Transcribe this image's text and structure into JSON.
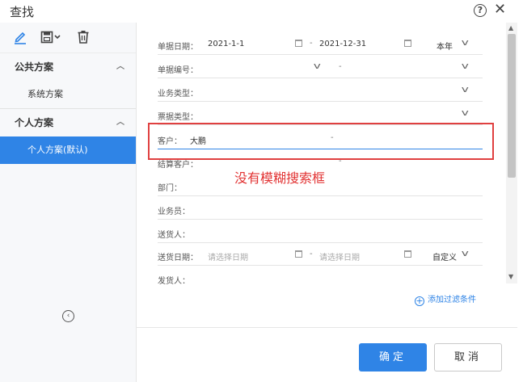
{
  "window": {
    "title": "查找",
    "help_glyph": "?",
    "close_glyph": "✕"
  },
  "sidebar": {
    "public_group": "公共方案",
    "public_items": [
      "系统方案"
    ],
    "personal_group": "个人方案",
    "personal_items": [
      "个人方案(默认)"
    ]
  },
  "filters": {
    "doc_date": {
      "label": "单据日期：",
      "from": "2021-1-1",
      "to": "2021-12-31",
      "dash": "-",
      "preset": "本年"
    },
    "doc_no": {
      "label": "单据编号：",
      "dash": "-"
    },
    "biz_type": {
      "label": "业务类型："
    },
    "ticket_type": {
      "label": "票据类型："
    },
    "customer": {
      "label": "客户：",
      "value": "大鹏",
      "dash": "-"
    },
    "settle_customer": {
      "label": "结算客户：",
      "dash": "-"
    },
    "dept": {
      "label": "部门："
    },
    "salesman": {
      "label": "业务员："
    },
    "deliverer": {
      "label": "送货人："
    },
    "delivery_date": {
      "label": "送货日期：",
      "from_placeholder": "请选择日期",
      "to_placeholder": "请选择日期",
      "dash": "-",
      "preset": "自定义"
    },
    "shipper": {
      "label": "发货人："
    }
  },
  "add_filter_label": "添加过滤条件",
  "annotation_text": "没有模糊搜索框",
  "buttons": {
    "ok": "确定",
    "cancel": "取消"
  },
  "colors": {
    "accent": "#2f84e6",
    "annotation": "#e23434"
  }
}
